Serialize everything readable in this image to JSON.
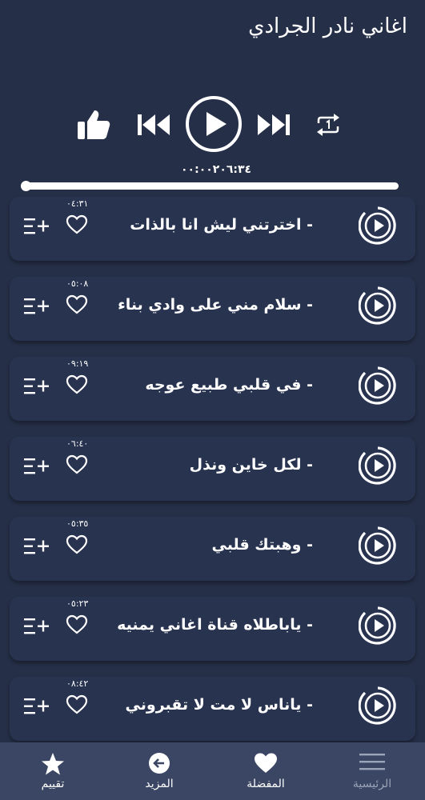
{
  "app": {
    "title": "اغاني نادر الجرادي"
  },
  "player": {
    "time_display": "٠٠:٠٠٢٠٦:٣٤",
    "progress_fraction": 0.0
  },
  "songs": [
    {
      "title": "-  اخترتني ليش انا بالذات",
      "duration": "٠٤:٣١"
    },
    {
      "title": "- سلام مني على وادي بناء",
      "duration": "٠٥:٠٨"
    },
    {
      "title": "- في قلبي طبيع عوجه",
      "duration": "٠٩:١٩"
    },
    {
      "title": "- لكل خاين ونذل",
      "duration": "٠٦:٤٠"
    },
    {
      "title": "- وهبتك قلبي",
      "duration": "٠٥:٣٥"
    },
    {
      "title": "- ياباطلاه قناة اغاني يمنيه",
      "duration": "٠٥:٢٣"
    },
    {
      "title": "- ياناس لا مت لا تقبروني",
      "duration": "٠٨:٤٢"
    }
  ],
  "nav": {
    "rate": "تقييم",
    "more": "المزيد",
    "favorites": "المفضلة",
    "home": "الرئيسية"
  },
  "colors": {
    "background": "#252f47",
    "card": "#283350",
    "nav_bar": "#3a4663",
    "inactive": "#9aa3b8"
  }
}
